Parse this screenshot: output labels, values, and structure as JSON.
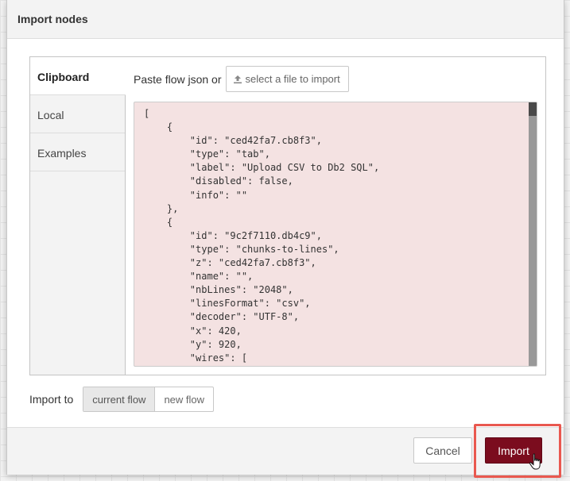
{
  "dialog": {
    "title": "Import nodes"
  },
  "tabs": [
    {
      "label": "Clipboard",
      "active": true
    },
    {
      "label": "Local",
      "active": false
    },
    {
      "label": "Examples",
      "active": false
    }
  ],
  "clipboard": {
    "paste_label": "Paste flow json or",
    "file_button_label": "select a file to import",
    "json_text": "[\n    {\n        \"id\": \"ced42fa7.cb8f3\",\n        \"type\": \"tab\",\n        \"label\": \"Upload CSV to Db2 SQL\",\n        \"disabled\": false,\n        \"info\": \"\"\n    },\n    {\n        \"id\": \"9c2f7110.db4c9\",\n        \"type\": \"chunks-to-lines\",\n        \"z\": \"ced42fa7.cb8f3\",\n        \"name\": \"\",\n        \"nbLines\": \"2048\",\n        \"linesFormat\": \"csv\",\n        \"decoder\": \"UTF-8\",\n        \"x\": 420,\n        \"y\": 920,\n        \"wires\": [\n            ["
  },
  "import_to": {
    "label": "Import to",
    "options": [
      {
        "label": "current flow",
        "active": true
      },
      {
        "label": "new flow",
        "active": false
      }
    ]
  },
  "footer": {
    "cancel_label": "Cancel",
    "import_label": "Import"
  },
  "colors": {
    "accent": "#7b0c1e",
    "highlight": "#e9584f",
    "editor_bg": "#f4e2e2"
  }
}
